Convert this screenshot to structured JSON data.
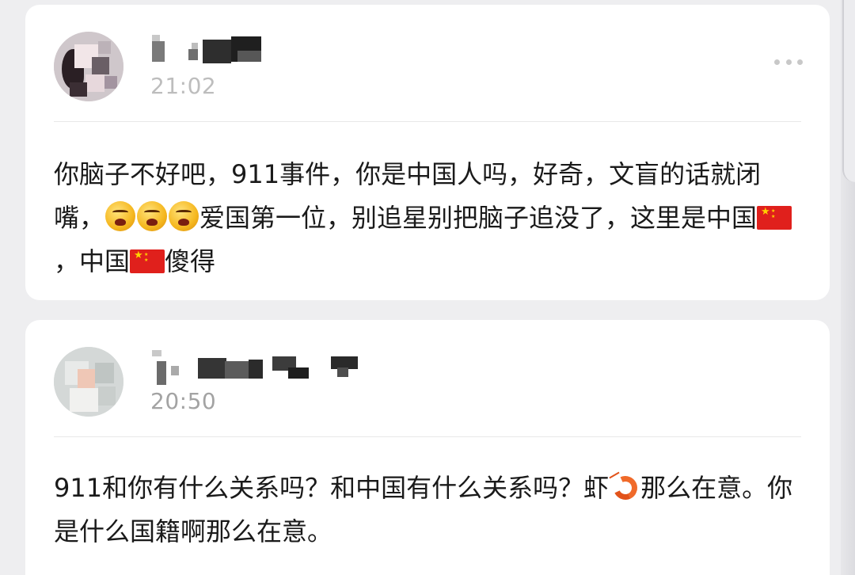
{
  "comments": [
    {
      "time": "21:02",
      "text_parts": [
        {
          "type": "text",
          "value": "你脑子不好吧，911事件，你是中国人吗，好奇，文盲的话就闭嘴，"
        },
        {
          "type": "emoji",
          "icon": "angry-face-icon"
        },
        {
          "type": "emoji",
          "icon": "angry-face-icon"
        },
        {
          "type": "emoji",
          "icon": "angry-face-icon"
        },
        {
          "type": "text",
          "value": "爱国第一位，别追星别把脑子追没了，这里是中国"
        },
        {
          "type": "emoji",
          "icon": "china-flag-icon"
        },
        {
          "type": "text",
          "value": "，中国"
        },
        {
          "type": "emoji",
          "icon": "china-flag-icon"
        },
        {
          "type": "text",
          "value": "傻得"
        }
      ]
    },
    {
      "time": "20:50",
      "text_parts": [
        {
          "type": "text",
          "value": "911和你有什么关系吗？和中国有什么关系吗？虾"
        },
        {
          "type": "emoji",
          "icon": "shrimp-icon"
        },
        {
          "type": "text",
          "value": "那么在意。你是什么国籍啊那么在意。"
        }
      ]
    }
  ],
  "colors": {
    "background": "#eeeef0",
    "card": "#ffffff",
    "text": "#1a1a1a",
    "time": "#a3a3a3",
    "divider": "#e8e8e8"
  }
}
